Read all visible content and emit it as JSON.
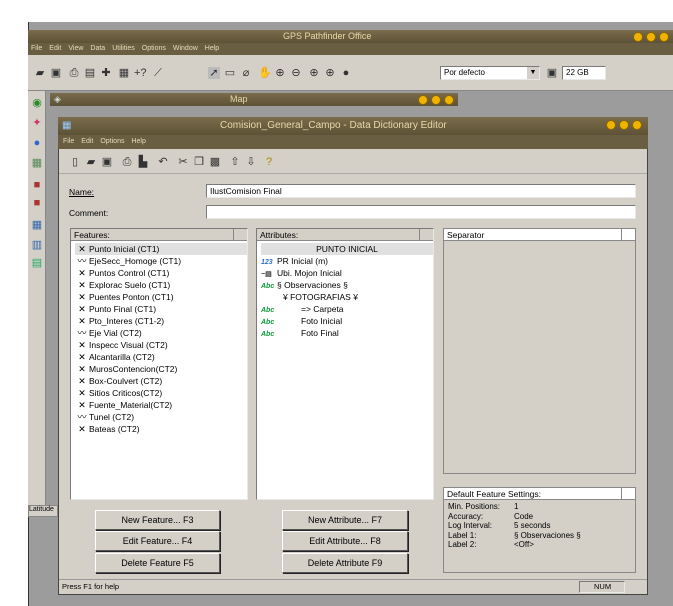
{
  "main_window": {
    "title": "GPS Pathfinder Office"
  },
  "main_menu": [
    "File",
    "Edit",
    "View",
    "Data",
    "Utilities",
    "Options",
    "Window",
    "Help"
  ],
  "main_toolbar": {
    "style_select": "Por defecto",
    "storage": "22 GB"
  },
  "map_window": {
    "title": "Map"
  },
  "status_left": "Latitude",
  "dde": {
    "title": "Comision_General_Campo - Data Dictionary Editor",
    "menu": [
      "File",
      "Edit",
      "Options",
      "Help"
    ],
    "name_label": "Name:",
    "name_value": "IlustComision Final",
    "comment_label": "Comment:",
    "comment_value": "",
    "features_header": "Features:",
    "features": [
      {
        "icon": "point",
        "label": "Punto Inicial  (CT1)"
      },
      {
        "icon": "line",
        "label": "EjeSecc_Homoge (CT1)"
      },
      {
        "icon": "point",
        "label": "Puntos Control (CT1)"
      },
      {
        "icon": "point",
        "label": "Explorac Suelo (CT1)"
      },
      {
        "icon": "point",
        "label": "Puentes Ponton (CT1)"
      },
      {
        "icon": "point",
        "label": "Punto Final   (CT1)"
      },
      {
        "icon": "point",
        "label": "Pto_Interes (CT1-2)"
      },
      {
        "icon": "line",
        "label": "Eje Vial     (CT2)"
      },
      {
        "icon": "point",
        "label": "Inspecc Visual (CT2)"
      },
      {
        "icon": "point",
        "label": "Alcantarilla  (CT2)"
      },
      {
        "icon": "point",
        "label": "MurosContencion(CT2)"
      },
      {
        "icon": "point",
        "label": "Box-Coulvert  (CT2)"
      },
      {
        "icon": "point",
        "label": "Sitios Criticos(CT2)"
      },
      {
        "icon": "point",
        "label": "Fuente_Material(CT2)"
      },
      {
        "icon": "line",
        "label": "Tunel        (CT2)"
      },
      {
        "icon": "point",
        "label": "Bateas       (CT2)"
      }
    ],
    "attributes_header": "Attributes:",
    "attributes": [
      {
        "icon": "none",
        "label": "PUNTO INICIAL",
        "indent": "center"
      },
      {
        "icon": "numeric",
        "label": "PR Inicial     (m)"
      },
      {
        "icon": "menu",
        "label": "Ubi. Mojon Inicial"
      },
      {
        "icon": "text",
        "label": "§  Observaciones  §"
      },
      {
        "icon": "none",
        "label": "¥  FOTOGRAFIAS  ¥"
      },
      {
        "icon": "text",
        "label": "=> Carpeta"
      },
      {
        "icon": "text",
        "label": "Foto Inicial"
      },
      {
        "icon": "text",
        "label": "Foto Final"
      }
    ],
    "separator_header": "Separator",
    "default_settings": {
      "title": "Default Feature Settings:",
      "rows": [
        {
          "k": "Min. Positions:",
          "v": "1"
        },
        {
          "k": "Accuracy:",
          "v": "Code"
        },
        {
          "k": "Log Interval:",
          "v": "5 seconds"
        },
        {
          "k": "Label 1:",
          "v": "§  Observaciones  §"
        },
        {
          "k": "Label 2:",
          "v": "<Off>"
        }
      ]
    },
    "buttons": {
      "new_feature": "New Feature... F3",
      "edit_feature": "Edit Feature... F4",
      "delete_feature": "Delete Feature F5",
      "new_attribute": "New Attribute... F7",
      "edit_attribute": "Edit Attribute... F8",
      "delete_attribute": "Delete Attribute F9"
    },
    "status_help": "Press F1 for help",
    "status_num": "NUM"
  }
}
